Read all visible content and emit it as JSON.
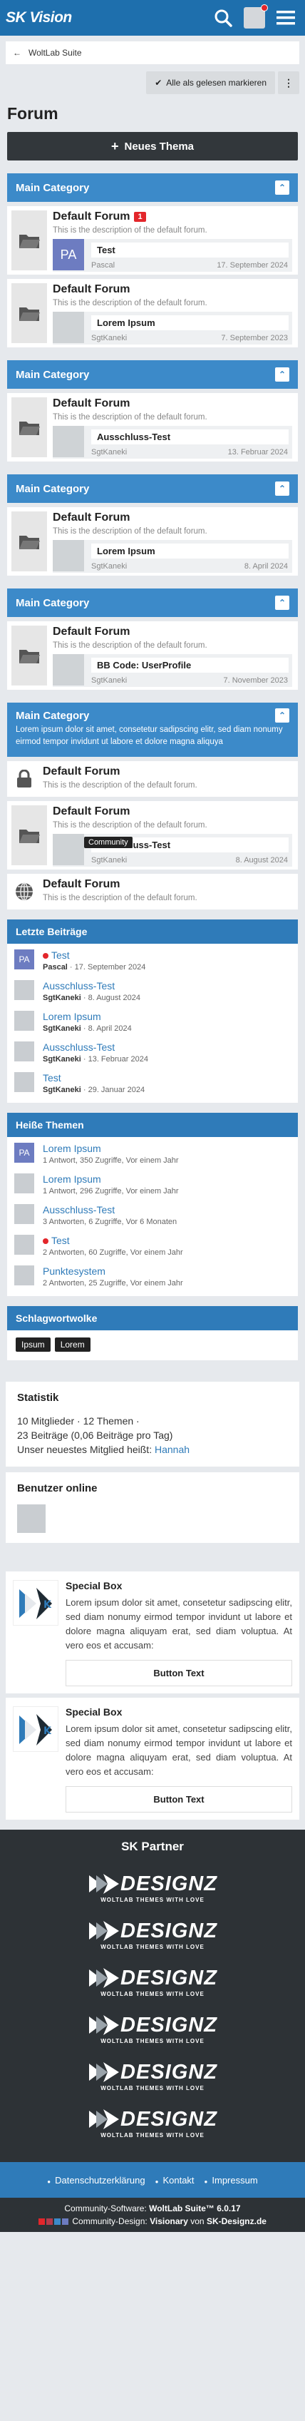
{
  "header": {
    "logo": "SK Vision"
  },
  "breadcrumb": {
    "label": "WoltLab Suite"
  },
  "toolbar": {
    "mark_read": "Alle als gelesen markieren",
    "more": "⋮"
  },
  "page_title": "Forum",
  "new_topic": "Neues Thema",
  "categories": [
    {
      "title": "Main Category",
      "boards": [
        {
          "title": "Default Forum",
          "badge": "1",
          "desc": "This is the description of the default forum.",
          "last_title": "Test",
          "last_user": "Pascal",
          "last_date": "17. September 2024",
          "avatar": "PA"
        },
        {
          "title": "Default Forum",
          "desc": "This is the description of the default forum.",
          "last_title": "Lorem Ipsum",
          "last_user": "SgtKaneki",
          "last_date": "7. September 2023"
        }
      ]
    },
    {
      "title": "Main Category",
      "boards": [
        {
          "title": "Default Forum",
          "desc": "This is the description of the default forum.",
          "last_title": "Ausschluss-Test",
          "last_user": "SgtKaneki",
          "last_date": "13. Februar 2024"
        }
      ]
    },
    {
      "title": "Main Category",
      "boards": [
        {
          "title": "Default Forum",
          "desc": "This is the description of the default forum.",
          "last_title": "Lorem Ipsum",
          "last_user": "SgtKaneki",
          "last_date": "8. April 2024"
        }
      ]
    },
    {
      "title": "Main Category",
      "boards": [
        {
          "title": "Default Forum",
          "desc": "This is the description of the default forum.",
          "last_title": "BB Code: UserProfile",
          "last_user": "SgtKaneki",
          "last_date": "7. November 2023"
        }
      ]
    },
    {
      "title": "Main Category",
      "desc": "Lorem ipsum dolor sit amet, consetetur sadipscing elitr, sed diam nonumy eirmod tempor invidunt ut labore et dolore magna aliquya",
      "boards": [
        {
          "title": "Default Forum",
          "desc": "This is the description of the default forum."
        },
        {
          "title": "Default Forum",
          "desc": "This is the description of the default forum.",
          "last_title": "Ausschluss-Test",
          "last_user": "SgtKaneki",
          "last_date": "8. August 2024",
          "tooltip": "Community"
        },
        {
          "title": "Default Forum",
          "desc": "This is the description of the default forum."
        }
      ]
    }
  ],
  "latest": {
    "title": "Letzte Beiträge",
    "items": [
      {
        "title": "Test",
        "user": "Pascal",
        "date": "17. September 2024",
        "avatar": "PA"
      },
      {
        "title": "Ausschluss-Test",
        "user": "SgtKaneki",
        "date": "8. August 2024"
      },
      {
        "title": "Lorem Ipsum",
        "user": "SgtKaneki",
        "date": "8. April 2024"
      },
      {
        "title": "Ausschluss-Test",
        "user": "SgtKaneki",
        "date": "13. Februar 2024"
      },
      {
        "title": "Test",
        "user": "SgtKaneki",
        "date": "29. Januar 2024"
      }
    ]
  },
  "hot": {
    "title": "Heiße Themen",
    "items": [
      {
        "title": "Lorem Ipsum",
        "meta": "1 Antwort, 350 Zugriffe, Vor einem Jahr",
        "avatar": "PA"
      },
      {
        "title": "Lorem Ipsum",
        "meta": "1 Antwort, 296 Zugriffe, Vor einem Jahr"
      },
      {
        "title": "Ausschluss-Test",
        "meta": "3 Antworten, 6 Zugriffe, Vor 6 Monaten"
      },
      {
        "title": "Test",
        "meta": "2 Antworten, 60 Zugriffe, Vor einem Jahr"
      },
      {
        "title": "Punktesystem",
        "meta": "2 Antworten, 25 Zugriffe, Vor einem Jahr"
      }
    ]
  },
  "tagcloud": {
    "title": "Schlagwortwolke",
    "tags": [
      "Ipsum",
      "Lorem"
    ]
  },
  "stats": {
    "title": "Statistik",
    "line1": "10 Mitglieder · 12 Themen ·",
    "line2": "23 Beiträge (0,06 Beiträge pro Tag)",
    "line3": "Unser neuestes Mitglied heißt:",
    "newest": "Hannah"
  },
  "online": {
    "title": "Benutzer online"
  },
  "special": [
    {
      "title": "Special Box",
      "text": "Lorem ipsum dolor sit amet, consetetur sadipscing elitr, sed diam nonumy eirmod tempor invidunt ut labore et dolore magna aliquyam erat, sed diam voluptua. At vero eos et accusam:",
      "button": "Button Text"
    },
    {
      "title": "Special Box",
      "text": "Lorem ipsum dolor sit amet, consetetur sadipscing elitr, sed diam nonumy eirmod tempor invidunt ut labore et dolore magna aliquyam erat, sed diam voluptua. At vero eos et accusam:",
      "button": "Button Text"
    }
  ],
  "partner": {
    "title": "SK Partner",
    "logo_text": "DESIGNZ",
    "logo_sub": "WOLTLAB THEMES WITH LOVE",
    "count": 6
  },
  "footer": {
    "links": [
      "Datenschutzerklärung",
      "Kontakt",
      "Impressum"
    ],
    "copy1_label": "Community-Software:",
    "copy1_value": "WoltLab Suite™ 6.0.17",
    "copy2_label": "Community-Design:",
    "copy2_value": "Visionary",
    "copy2_by": "von",
    "copy2_site": "SK-Designz.de"
  },
  "colors": {
    "primary": "#1e6fad",
    "category": "#3c8ac9",
    "dark": "#2d3236",
    "accent_red": "#e3262b"
  }
}
